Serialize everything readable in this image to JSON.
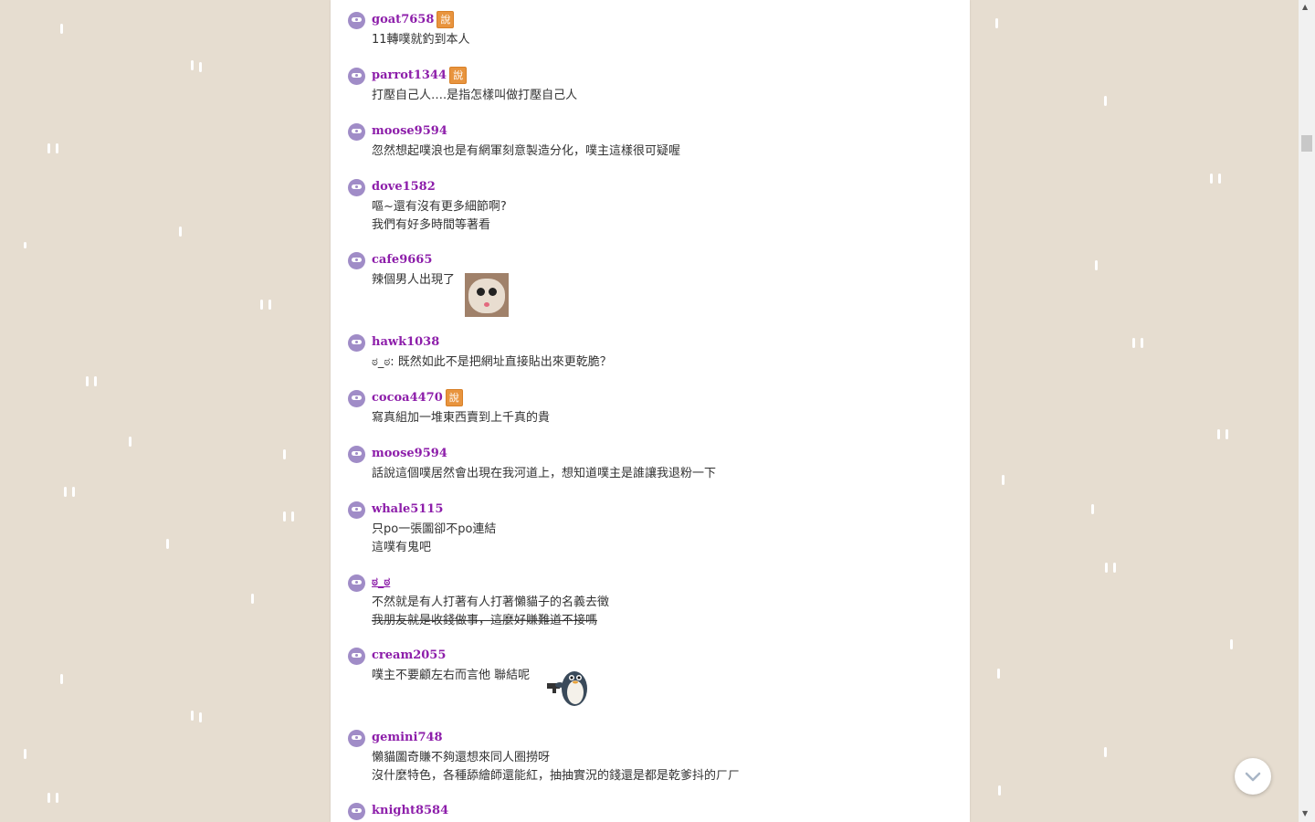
{
  "say_label": "說",
  "responses": [
    {
      "user": "goat7658",
      "say": true,
      "lines": [
        "11轉噗就釣到本人"
      ]
    },
    {
      "user": "parrot1344",
      "say": true,
      "lines": [
        "打壓自己人….是指怎樣叫做打壓自己人"
      ]
    },
    {
      "user": "moose9594",
      "say": false,
      "lines": [
        "忽然想起噗浪也是有網軍刻意製造分化，噗主這樣很可疑喔"
      ]
    },
    {
      "user": "dove1582",
      "say": false,
      "lines": [
        "嘔~還有沒有更多細節啊?",
        "我們有好多時間等著看"
      ]
    },
    {
      "user": "cafe9665",
      "say": false,
      "lines": [
        "辣個男人出現了"
      ]
    },
    {
      "user": "hawk1038",
      "say": false,
      "lines": [
        "ಠ_ಠ: 既然如此不是把網址直接貼出來更乾脆？"
      ]
    },
    {
      "user": "cocoa4470",
      "say": true,
      "lines": [
        "寫真組加一堆東西賣到上千真的貴"
      ]
    },
    {
      "user": "moose9594",
      "say": false,
      "lines": [
        "話說這個噗居然會出現在我河道上，想知道噗主是誰讓我退粉一下"
      ]
    },
    {
      "user": "whale5115",
      "say": false,
      "lines": [
        "只po一張圖卻不po連結",
        "這噗有鬼吧"
      ]
    },
    {
      "user": "ಠ_ಠ",
      "say": false,
      "lines": [
        "不然就是有人打著有人打著懶貓子的名義去徵"
      ],
      "struck": "我朋友就是收錢做事，這麼好賺難道不接嗎"
    },
    {
      "user": "cream2055",
      "say": false,
      "lines": [
        "噗主不要顧左右而言他 聯結呢"
      ]
    },
    {
      "user": "gemini748",
      "say": false,
      "lines": [
        "懶貓圖奇賺不夠還想來同人圈撈呀",
        "沒什麼特色，各種舔繪師還能紅，抽抽實況的錢還是都是乾爹抖的ㄏㄏ"
      ]
    },
    {
      "user": "knight8584",
      "say": false,
      "lines": []
    }
  ],
  "icons": {
    "avatar": "mask-avatar-icon",
    "sticker_cat": "surprised-cat-sticker",
    "sticker_penguin": "penguin-gun-sticker",
    "scroll_down": "chevron-down-icon"
  }
}
